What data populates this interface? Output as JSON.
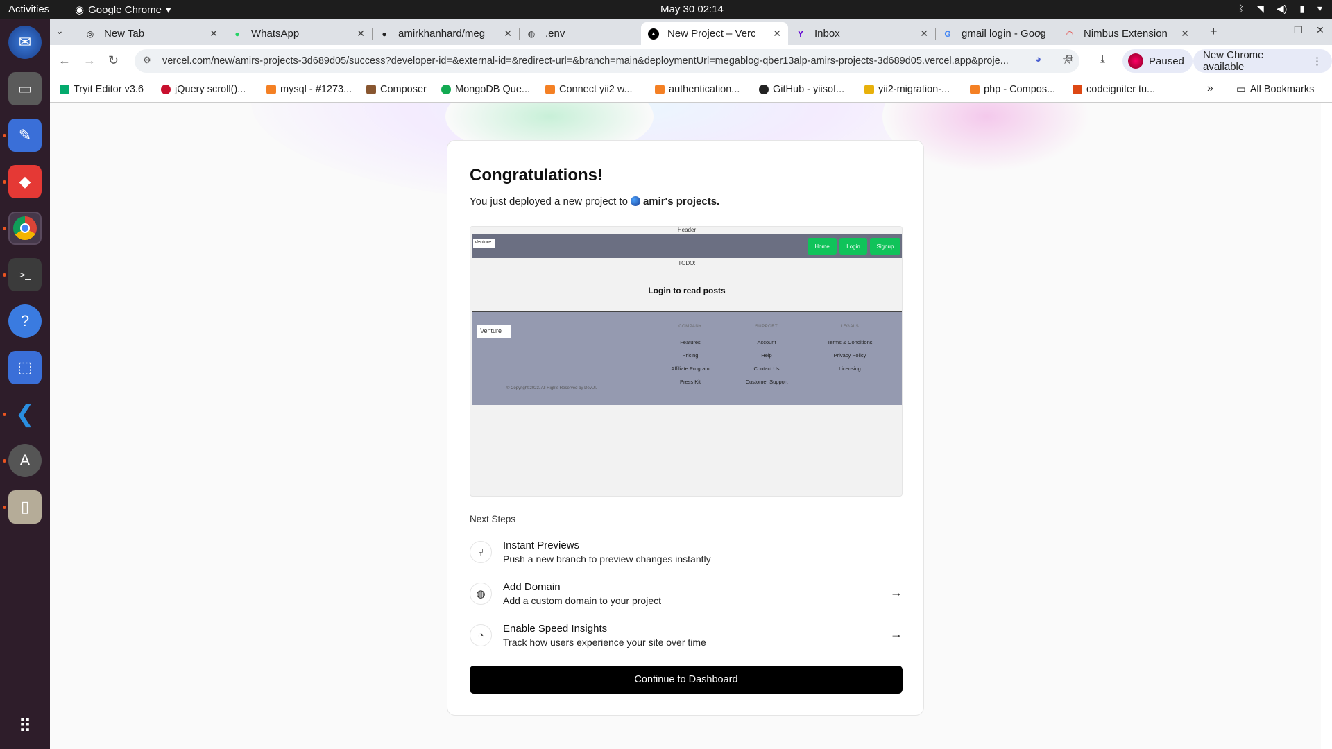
{
  "system": {
    "activities": "Activities",
    "app_menu": "Google Chrome",
    "clock": "May 30  02:14"
  },
  "tabs": [
    {
      "label": "New Tab",
      "icon": "chrome-icon"
    },
    {
      "label": "WhatsApp",
      "icon": "whatsapp-icon"
    },
    {
      "label": "amirkhanhard/meg",
      "icon": "github-icon"
    },
    {
      "label": ".env",
      "icon": "globe-icon"
    },
    {
      "label": "New Project – Verc",
      "icon": "vercel-icon"
    },
    {
      "label": "Inbox",
      "icon": "yahoo-icon"
    },
    {
      "label": "gmail login - Googl",
      "icon": "google-icon"
    },
    {
      "label": "Nimbus Extension",
      "icon": "nimbus-icon"
    }
  ],
  "toolbar": {
    "url": "vercel.com/new/amirs-projects-3d689d05/success?developer-id=&external-id=&redirect-url=&branch=main&deploymentUrl=megablog-qber13alp-amirs-projects-3d689d05.vercel.app&proje...",
    "profile": "Paused",
    "update": "New Chrome available"
  },
  "bookmarks": [
    "Tryit Editor v3.6",
    "jQuery scroll()...",
    "mysql - #1273...",
    "Composer",
    "MongoDB Que...",
    "Connect yii2 w...",
    "authentication...",
    "GitHub - yiisof...",
    "yii2-migration-...",
    "php - Compos...",
    "codeigniter tu..."
  ],
  "bookmarks_all": "All Bookmarks",
  "card": {
    "title": "Congratulations!",
    "subtitle_pre": "You just deployed a new project to",
    "subtitle_team": "amir's projects."
  },
  "preview": {
    "header": "Header",
    "logo": "Venture",
    "nav": [
      "Home",
      "Login",
      "Signup"
    ],
    "todo": "TODO:",
    "login_msg": "Login to read posts",
    "footer": {
      "company_head": "COMPANY",
      "company": [
        "Features",
        "Pricing",
        "Affiliate Program",
        "Press Kit"
      ],
      "support_head": "SUPPORT",
      "support": [
        "Account",
        "Help",
        "Contact Us",
        "Customer Support"
      ],
      "legals_head": "LEGALS",
      "legals": [
        "Terms & Conditions",
        "Privacy Policy",
        "Licensing"
      ],
      "copyright": "© Copyright 2023. All Rights Reserved by DevUI."
    }
  },
  "next_steps": {
    "heading": "Next Steps",
    "items": [
      {
        "title": "Instant Previews",
        "desc": "Push a new branch to preview changes instantly",
        "icon": "git-branch-icon"
      },
      {
        "title": "Add Domain",
        "desc": "Add a custom domain to your project",
        "icon": "globe-icon"
      },
      {
        "title": "Enable Speed Insights",
        "desc": "Track how users experience your site over time",
        "icon": "speed-gauge-icon"
      }
    ]
  },
  "cta": "Continue to Dashboard"
}
